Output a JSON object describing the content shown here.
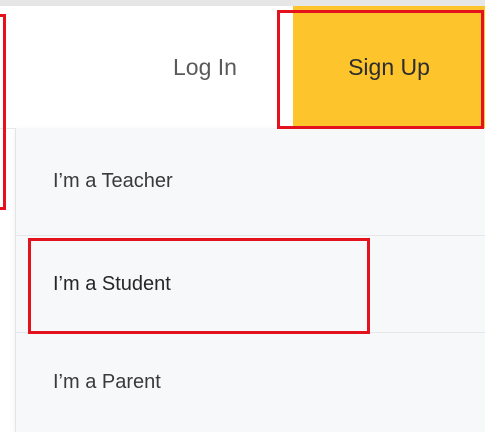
{
  "header": {
    "login_label": "Log In",
    "signup_label": "Sign Up"
  },
  "dropdown": {
    "items": [
      {
        "label": "I’m a Teacher"
      },
      {
        "label": "I’m a Student"
      },
      {
        "label": "I’m a Parent"
      }
    ]
  },
  "colors": {
    "signup_background": "#fdc42c",
    "dropdown_background": "#f7f8fa",
    "annotation_red": "#e3121d"
  }
}
